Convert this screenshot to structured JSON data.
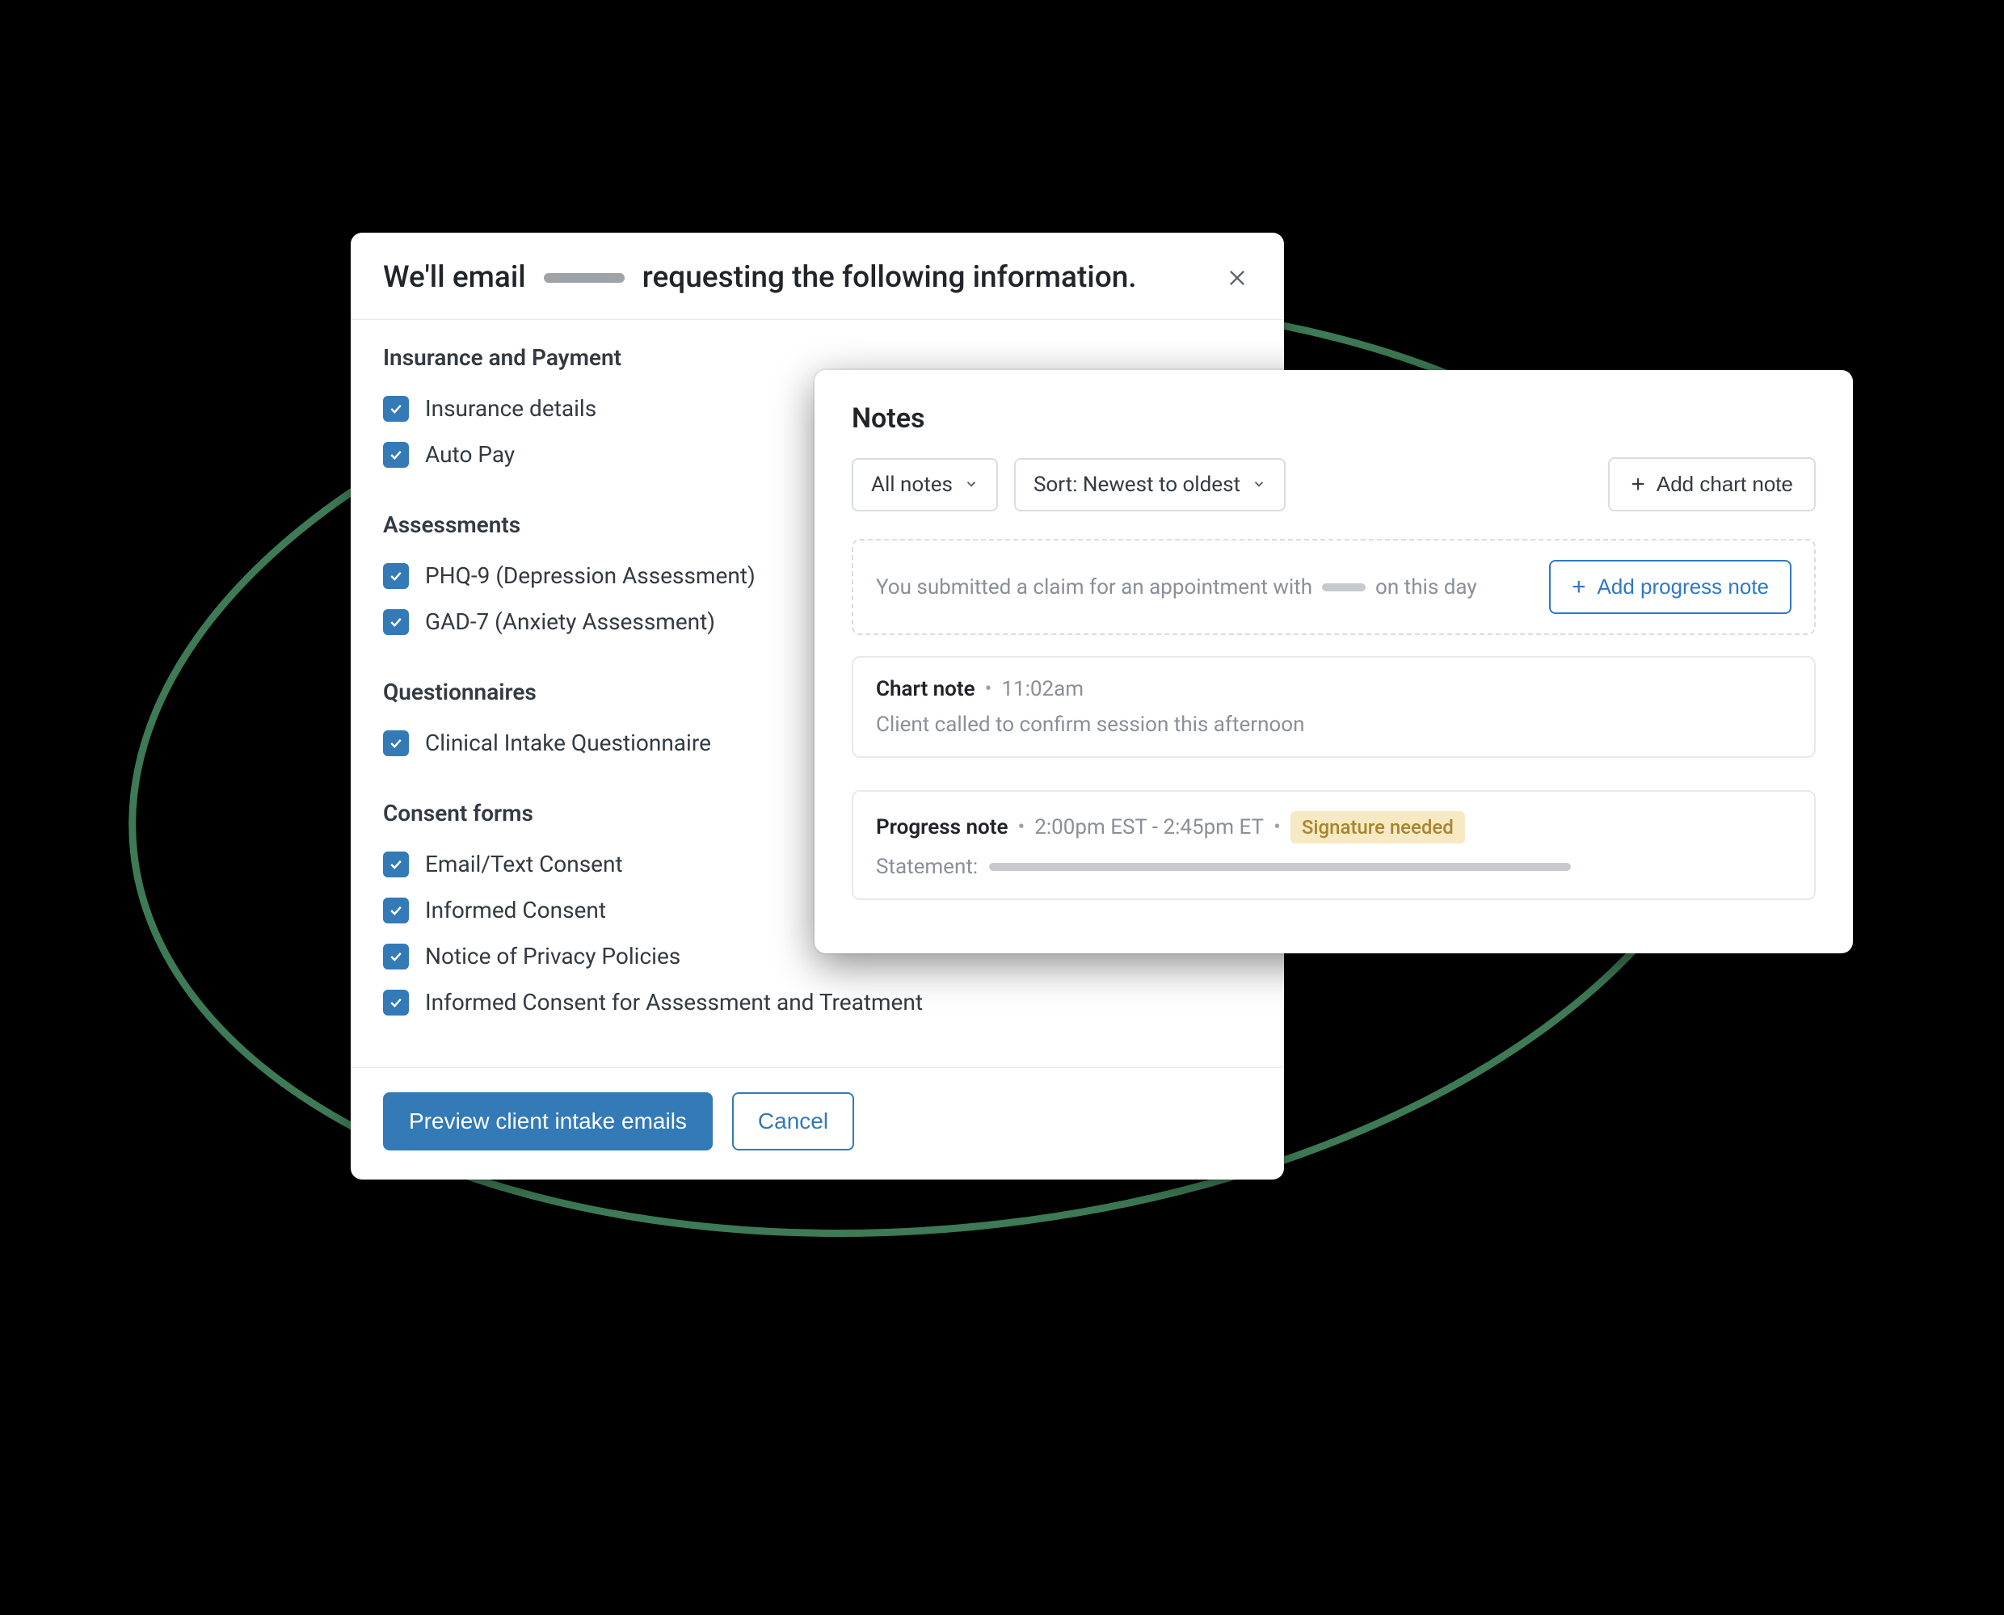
{
  "colors": {
    "accent": "#337ab7",
    "oval_stroke": "#3d7a55"
  },
  "intake": {
    "header_prefix": "We'll email",
    "header_suffix": "requesting the following information.",
    "sections": {
      "insurance": {
        "title": "Insurance and Payment",
        "items": [
          "Insurance details",
          "Auto Pay"
        ]
      },
      "assessments": {
        "title": "Assessments",
        "items": [
          "PHQ-9 (Depression Assessment)",
          "GAD-7 (Anxiety Assessment)"
        ]
      },
      "questionnaires": {
        "title": "Questionnaires",
        "items": [
          "Clinical Intake Questionnaire"
        ]
      },
      "consent": {
        "title": "Consent forms",
        "items": [
          "Email/Text Consent",
          "Informed Consent",
          "Notice of Privacy Policies",
          "Informed Consent for Assessment and Treatment"
        ]
      }
    },
    "preview_btn": "Preview client intake emails",
    "cancel_btn": "Cancel"
  },
  "notes": {
    "title": "Notes",
    "filter_label": "All notes",
    "sort_label": "Sort: Newest to oldest",
    "add_chart_btn": "Add chart note",
    "add_progress_btn": "Add progress note",
    "claim_msg_prefix": "You submitted a claim for an appointment with",
    "claim_msg_suffix": "on this day",
    "card1": {
      "type": "Chart note",
      "time": "11:02am",
      "body": "Client called to confirm session this afternoon"
    },
    "card2": {
      "type": "Progress note",
      "time": "2:00pm EST - 2:45pm ET",
      "signature_tag": "Signature needed",
      "statement_label": "Statement:"
    }
  }
}
